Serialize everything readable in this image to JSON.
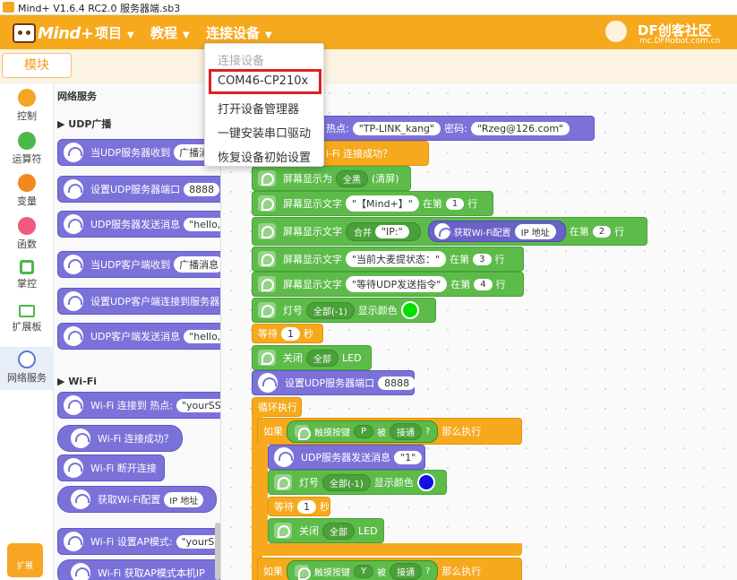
{
  "window": {
    "title": "Mind+ V1.6.4 RC2.0   服务器端.sb3"
  },
  "menubar": {
    "logo": "Mind+",
    "items": [
      {
        "label": "项目"
      },
      {
        "label": "教程"
      },
      {
        "label": "连接设备"
      }
    ],
    "df_brand": "DF创客社区",
    "df_url": "mc.DFRobot.com.cn"
  },
  "tabs": {
    "blocks": "模块"
  },
  "categories": [
    {
      "label": "控制",
      "color": "#f6a623"
    },
    {
      "label": "运算符",
      "color": "#4cb84a"
    },
    {
      "label": "变量",
      "color": "#f4881e"
    },
    {
      "label": "函数",
      "color": "#f05a7e"
    },
    {
      "label": "掌控",
      "color": "#4cb84a"
    },
    {
      "label": "扩展板",
      "color": "#4cb84a"
    },
    {
      "label": "网络服务",
      "color": "#5b7bd6"
    }
  ],
  "extension_button": "扩展",
  "palette": {
    "section_title": "网络服务",
    "udp_header": "UDP广播",
    "udp_blocks": [
      {
        "text": "当UDP服务器收到",
        "field": "广播消"
      },
      {
        "text": "设置UDP服务器端口",
        "field": "8888"
      },
      {
        "text": "UDP服务器发送消息",
        "field": "\"hello,"
      },
      {
        "text": "当UDP客户端收到",
        "field": "广播消息"
      },
      {
        "text": "设置UDP客户端连接到服务器",
        "field": ""
      },
      {
        "text": "UDP客户端发送消息",
        "field": "\"hello,"
      }
    ],
    "wifi_header": "Wi-Fi",
    "wifi_blocks": [
      {
        "text": "Wi-Fi 连接到 热点:",
        "field": "\"yourSS"
      },
      {
        "text": "Wi-Fi 连接成功？",
        "field": ""
      },
      {
        "text": "Wi-Fi 断开连接",
        "field": ""
      },
      {
        "text": "获取Wi-Fi配置",
        "field": "IP 地址"
      },
      {
        "text": "Wi-Fi 设置AP模式:",
        "field": "\"yourSS"
      },
      {
        "text": "Wi-Fi 获取AP模式本机IP",
        "field": ""
      }
    ]
  },
  "device_menu": {
    "items": [
      "连接设备",
      "COM46-CP210x",
      "打开设备管理器",
      "一键安装串口驱动",
      "恢复设备初始设置"
    ]
  },
  "workspace": {
    "wifi_connect": {
      "prefix": "热点:",
      "ssid": "\"TP-LINK_kang\"",
      "pwd_label": "密码:",
      "pwd": "\"Rzeg@126.com\""
    },
    "wifi_ok": "i-Fi 连接成功？",
    "screen_show": {
      "label": "屏幕显示为",
      "color": "全黑",
      "suffix": "(清屏)"
    },
    "text1": {
      "label": "屏幕显示文字",
      "text": "\"【Mind+】\"",
      "at": "在第",
      "line": "1",
      "row": "行"
    },
    "text2": {
      "label": "屏幕显示文字",
      "merge": "合并",
      "ip": "\"IP:\"",
      "get": "获取Wi-Fi配置",
      "field": "IP 地址",
      "at": "在第",
      "line": "2",
      "row": "行"
    },
    "text3": {
      "label": "屏幕显示文字",
      "text": "\"当前大麦提状态：\"",
      "at": "在第",
      "line": "3",
      "row": "行"
    },
    "text4": {
      "label": "屏幕显示文字",
      "text": "\"等待UDP发送指令\"",
      "at": "在第",
      "line": "4",
      "row": "行"
    },
    "led1": {
      "label": "灯号",
      "sel": "全部(-1)",
      "show": "显示颜色",
      "color": "#00e000"
    },
    "wait1": {
      "label": "等待",
      "val": "1",
      "unit": "秒"
    },
    "off1": {
      "label": "关闭",
      "sel": "全部",
      "led": "LED"
    },
    "udp_port": {
      "label": "设置UDP服务器端口",
      "val": "8888"
    },
    "loop": "循环执行",
    "if1": {
      "if": "如果",
      "touch": "触摸按键",
      "key": "P",
      "is": "被",
      "state": "接通",
      "q": "?",
      "then": "那么执行"
    },
    "udp_send": {
      "label": "UDP服务器发送消息",
      "val": "\"1\""
    },
    "led2": {
      "label": "灯号",
      "sel": "全部(-1)",
      "show": "显示颜色",
      "color": "#1010e0"
    },
    "wait2": {
      "label": "等待",
      "val": "1",
      "unit": "秒"
    },
    "off2": {
      "label": "关闭",
      "sel": "全部",
      "led": "LED"
    },
    "if2": {
      "if": "如果",
      "touch": "触摸按键",
      "key": "Y",
      "is": "被",
      "state": "接通",
      "q": "?",
      "then": "那么执行"
    }
  }
}
